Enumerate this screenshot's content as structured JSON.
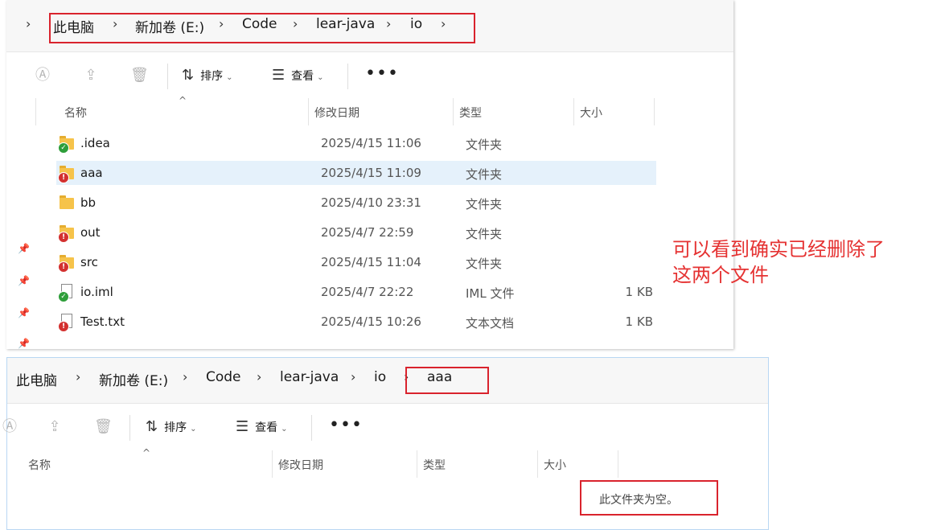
{
  "top": {
    "path": [
      "此电脑",
      "新加卷 (E:)",
      "Code",
      "lear-java",
      "io"
    ],
    "toolbar": {
      "sort_label": "排序",
      "view_label": "查看",
      "more_label": "•••"
    },
    "columns": {
      "name": "名称",
      "date": "修改日期",
      "type": "类型",
      "size": "大小"
    },
    "files": [
      {
        "name": ".idea",
        "date": "2025/4/15 11:06",
        "type": "文件夹",
        "size": "",
        "kind": "folder",
        "status": "ok"
      },
      {
        "name": "aaa",
        "date": "2025/4/15 11:09",
        "type": "文件夹",
        "size": "",
        "kind": "folder",
        "status": "err",
        "selected": true
      },
      {
        "name": "bb",
        "date": "2025/4/10 23:31",
        "type": "文件夹",
        "size": "",
        "kind": "folder",
        "status": "none"
      },
      {
        "name": "out",
        "date": "2025/4/7 22:59",
        "type": "文件夹",
        "size": "",
        "kind": "folder",
        "status": "err"
      },
      {
        "name": "src",
        "date": "2025/4/15 11:04",
        "type": "文件夹",
        "size": "",
        "kind": "folder",
        "status": "err"
      },
      {
        "name": "io.iml",
        "date": "2025/4/7 22:22",
        "type": "IML 文件",
        "size": "1 KB",
        "kind": "file",
        "status": "ok"
      },
      {
        "name": "Test.txt",
        "date": "2025/4/15 10:26",
        "type": "文本文档",
        "size": "1 KB",
        "kind": "file",
        "status": "err"
      }
    ]
  },
  "bottom": {
    "path": [
      "此电脑",
      "新加卷 (E:)",
      "Code",
      "lear-java",
      "io",
      "aaa"
    ],
    "toolbar": {
      "sort_label": "排序",
      "view_label": "查看",
      "more_label": "•••"
    },
    "columns": {
      "name": "名称",
      "date": "修改日期",
      "type": "类型",
      "size": "大小"
    },
    "empty_text": "此文件夹为空。"
  },
  "annotation": {
    "line1": "可以看到确实已经删除了",
    "line2": "这两个文件"
  },
  "colors": {
    "annotation_red": "#e53232",
    "folder": "#f6c34a",
    "selection": "#e5f1fb"
  }
}
